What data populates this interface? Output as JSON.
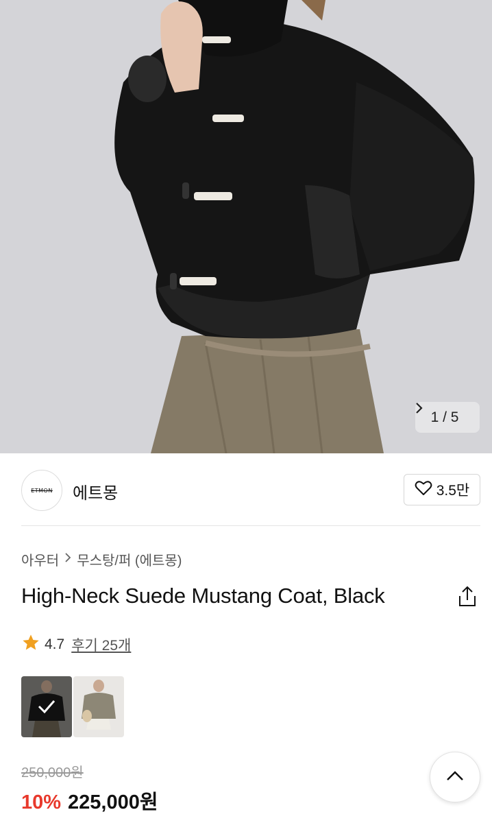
{
  "hero": {
    "counter": "1 / 5",
    "counter_icon": "chevron-right-icon"
  },
  "brand": {
    "logo_text": "ETMON",
    "name": "에트몽",
    "like_icon": "heart-icon",
    "like_count": "3.5만"
  },
  "breadcrumb": {
    "level1": "아우터",
    "level2": "무스탕/퍼 (에트몽)"
  },
  "product": {
    "title": "High-Neck Suede Mustang Coat, Black",
    "share_icon": "share-icon",
    "rating": "4.7",
    "reviews": "후기 25개",
    "original_price": "250,000원",
    "discount": "10%",
    "sale_price": "225,000원"
  },
  "options": {
    "colors": [
      {
        "name": "black",
        "selected": true
      },
      {
        "name": "beige",
        "selected": false
      }
    ]
  },
  "colors": {
    "discount": "#e8392c",
    "star": "#f0a020"
  }
}
